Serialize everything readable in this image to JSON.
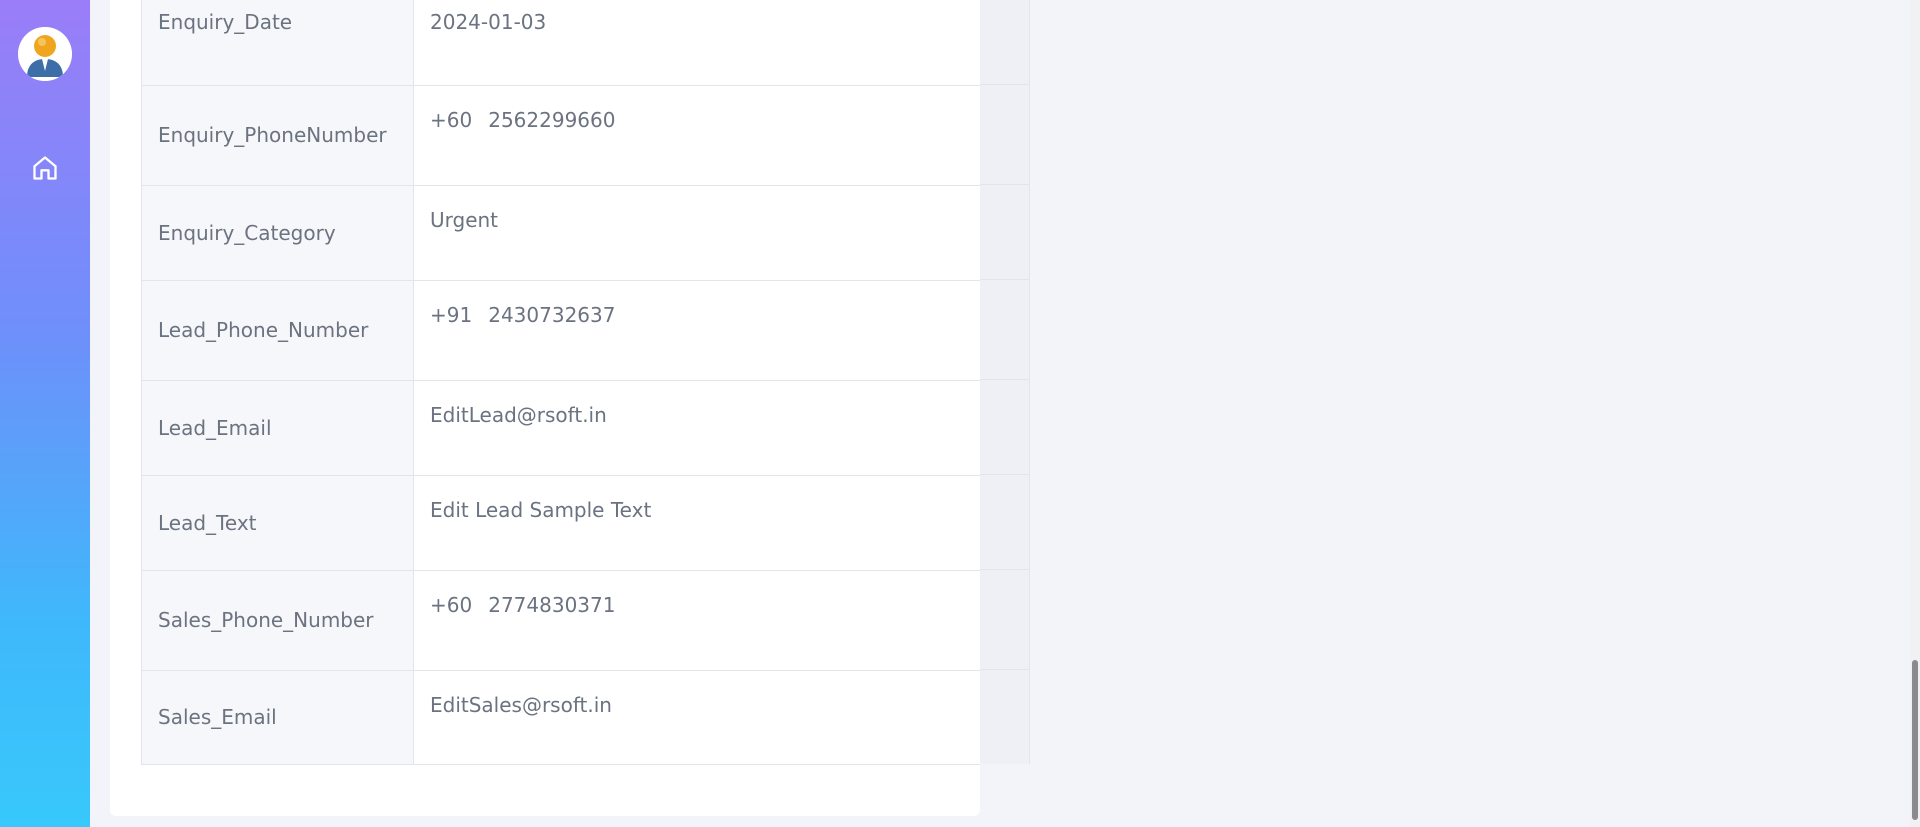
{
  "sidebar": {
    "avatar_icon": "user-avatar-icon",
    "nav": [
      {
        "icon": "home-icon"
      }
    ]
  },
  "details": {
    "rows": [
      {
        "label": "Enquiry_Date",
        "value": "2024-01-03"
      },
      {
        "label": "Enquiry_PhoneNumber",
        "code": "+60",
        "value": "2562299660"
      },
      {
        "label": "Enquiry_Category",
        "value": "Urgent"
      },
      {
        "label": "Lead_Phone_Number",
        "code": "+91",
        "value": "2430732637"
      },
      {
        "label": "Lead_Email",
        "value": "EditLead@rsoft.in"
      },
      {
        "label": "Lead_Text",
        "value": "Edit Lead Sample Text"
      },
      {
        "label": "Sales_Phone_Number",
        "code": "+60",
        "value": "2774830371"
      },
      {
        "label": "Sales_Email",
        "value": "EditSales@rsoft.in"
      }
    ]
  },
  "colors": {
    "sidebar_top": "#9a7df8",
    "sidebar_bottom": "#38c8fb",
    "text": "#6b7280",
    "label_bg": "#f6f7fb"
  }
}
